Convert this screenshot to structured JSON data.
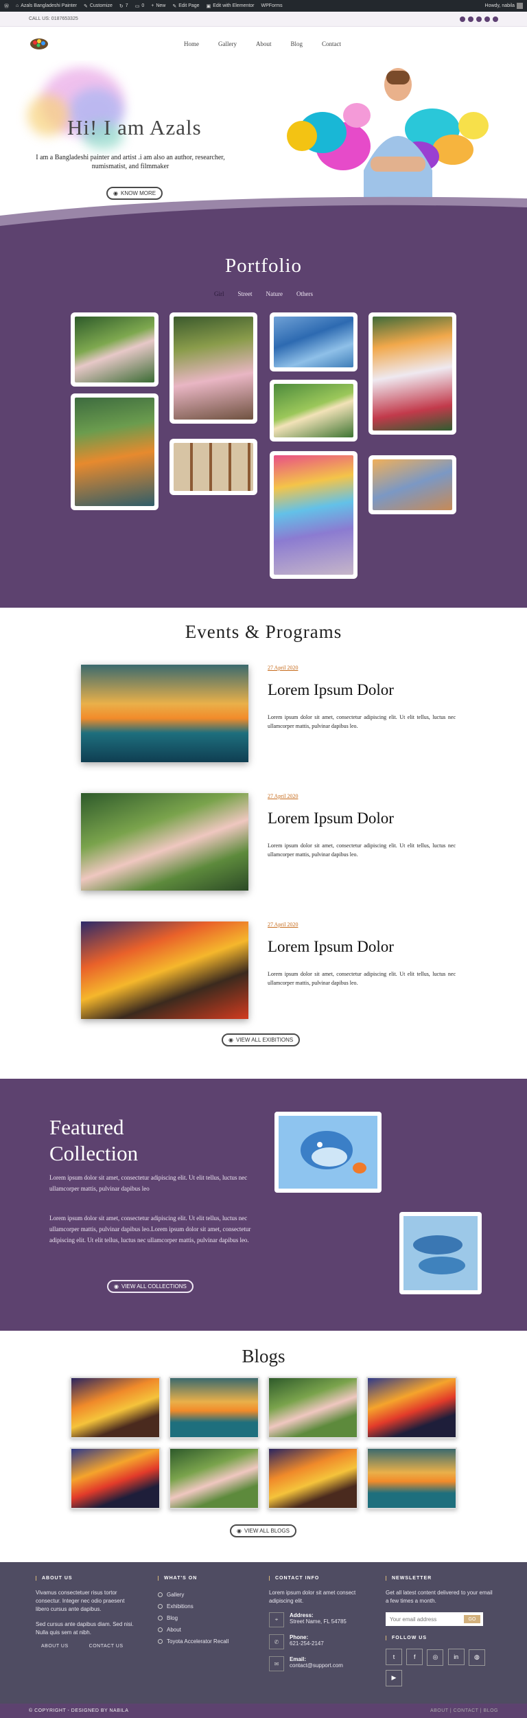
{
  "admin_bar": {
    "site": "Azals Bangladeshi Painter",
    "customize": "Customize",
    "updates": "7",
    "comments": "0",
    "new": "New",
    "edit_page": "Edit Page",
    "elementor": "Edit with Elementor",
    "wpforms": "WPForms",
    "howdy": "Howdy, nabila"
  },
  "topbar": {
    "call": "CALL US: 0187653325"
  },
  "nav": {
    "items": [
      "Home",
      "Gallery",
      "About",
      "Blog",
      "Contact"
    ]
  },
  "hero": {
    "title": "Hi! I am Azals",
    "subtitle": "I am a Bangladeshi painter and artist .i am also an author, researcher, numismatist, and filmmaker",
    "button": "KNOW MORE"
  },
  "portfolio": {
    "title": "Portfolio",
    "filters": [
      "Girl",
      "Street",
      "Nature",
      "Others"
    ],
    "active_filter": "Girl"
  },
  "events": {
    "title": "Events & Programs",
    "items": [
      {
        "date": "27 April 2020",
        "heading": "Lorem Ipsum Dolor",
        "text": "Lorem ipsum dolor sit amet, consectetur adipiscing elit. Ut elit tellus, luctus nec ullamcorper mattis, pulvinar dapibus leo."
      },
      {
        "date": "27 April 2020",
        "heading": "Lorem Ipsum Dolor",
        "text": "Lorem ipsum dolor sit amet, consectetur adipiscing elit. Ut elit tellus, luctus nec ullamcorper mattis, pulvinar dapibus leo."
      },
      {
        "date": "27 April 2020",
        "heading": "Lorem Ipsum Dolor",
        "text": "Lorem ipsum dolor sit amet, consectetur adipiscing elit. Ut elit tellus, luctus nec ullamcorper mattis, pulvinar dapibus leo."
      }
    ],
    "button": "VIEW ALL EXIBITIONS"
  },
  "featured": {
    "title": "Featured Collection",
    "para1": "Lorem ipsum dolor sit amet, consectetur adipiscing elit. Ut elit tellus, luctus nec ullamcorper mattis, pulvinar dapibus leo",
    "para2": "Lorem ipsum dolor sit amet, consectetur adipiscing elit. Ut elit tellus, luctus nec ullamcorper mattis, pulvinar dapibus leo.Lorem ipsum dolor sit amet, consectetur adipiscing elit. Ut elit tellus, luctus nec ullamcorper mattis, pulvinar dapibus leo.",
    "button": "VIEW ALL COLLECTIONS"
  },
  "blogs": {
    "title": "Blogs",
    "button": "VIEW ALL BLOGS"
  },
  "footer": {
    "about": {
      "heading": "ABOUT US",
      "text1": "Vivamus consectetuer risus tortor consectur. Integer nec odio praesent libero cursus ante dapibus.",
      "text2": "Sed cursus ante dapibus diam. Sed nisi. Nulla quis sem at nibh.",
      "link1": "ABOUT US",
      "link2": "CONTACT US"
    },
    "whats_on": {
      "heading": "WHAT'S ON",
      "items": [
        "Gallery",
        "Exhibitions",
        "Blog",
        "About",
        "Toyota Accelerator Recall"
      ]
    },
    "contact": {
      "heading": "CONTACT INFO",
      "intro": "Lorem ipsum dolor sit amet consect adipiscing elit.",
      "address_label": "Address:",
      "address": "Street Name, FL 54785",
      "phone_label": "Phone:",
      "phone": "621-254-2147",
      "email_label": "Email:",
      "email": "contact@support.com"
    },
    "newsletter": {
      "heading": "NEWSLETTER",
      "text": "Get all latest content delivered to your email a few times a month.",
      "placeholder": "Your email address",
      "button": "GO",
      "follow": "FOLLOW US"
    }
  },
  "bottom": {
    "copyright": "© COPYRIGHT - DESIGNED BY NABILA",
    "links": "ABOUT | CONTACT | BLOG"
  },
  "colors": {
    "purple": "#5d426f",
    "footer": "#4f4c62",
    "gold": "#d2b07c"
  }
}
